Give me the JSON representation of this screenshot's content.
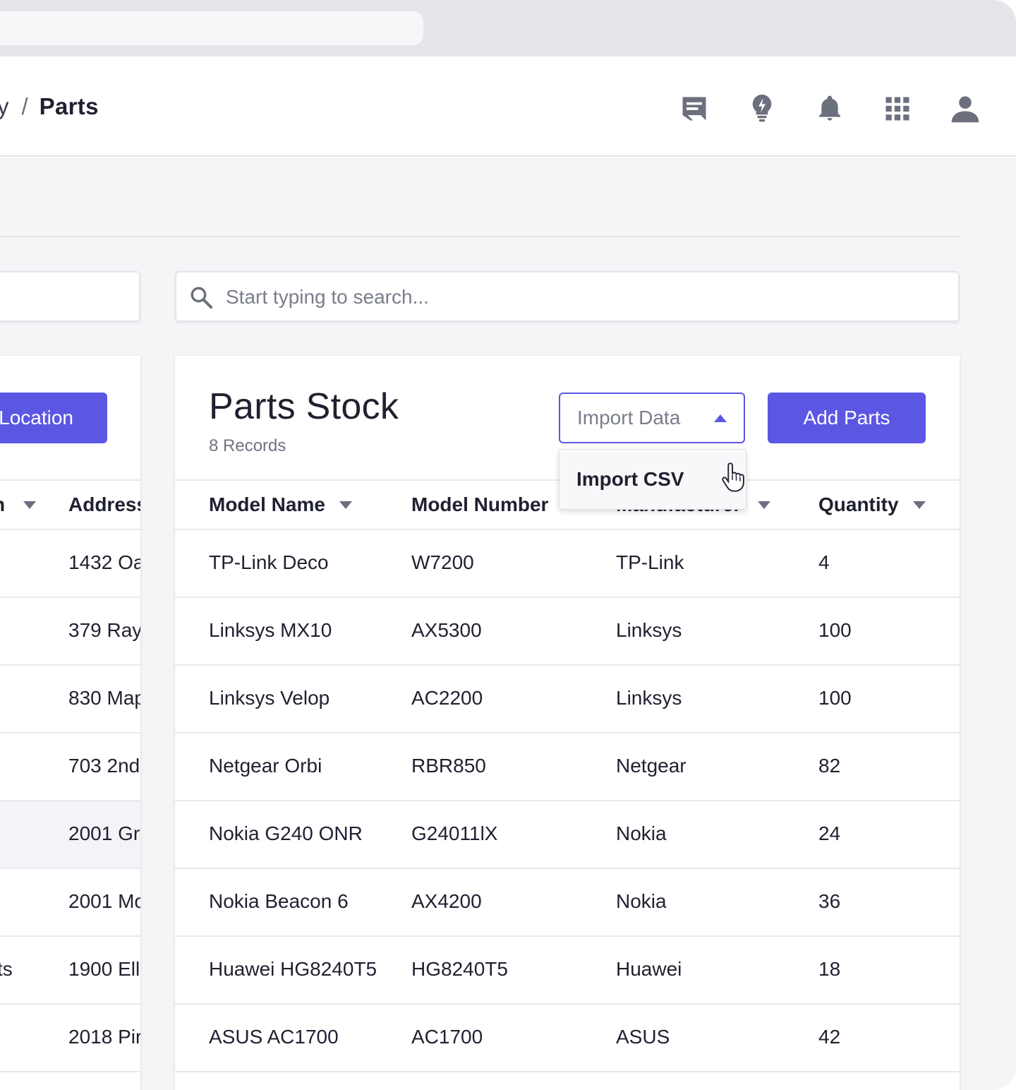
{
  "breadcrumb": {
    "previous": "y",
    "separator": "/",
    "current": "Parts"
  },
  "header_icons": [
    "chat-icon",
    "lightbulb-icon",
    "bell-icon",
    "apps-grid-icon",
    "user-icon"
  ],
  "search": {
    "placeholder": "Start typing to search..."
  },
  "left_panel": {
    "button_label": "Location",
    "columns": [
      "n",
      "Address"
    ],
    "rows": [
      {
        "a": "",
        "b": "1432 Oa"
      },
      {
        "a": "",
        "b": "379 Ray"
      },
      {
        "a": "",
        "b": "830 Map"
      },
      {
        "a": "",
        "b": "703 2nd"
      },
      {
        "a": "",
        "b": "2001 Gr"
      },
      {
        "a": "",
        "b": "2001 Mo"
      },
      {
        "a": "ts",
        "b": "1900 Ell"
      },
      {
        "a": "",
        "b": "2018 Pir"
      }
    ]
  },
  "panel": {
    "title": "Parts Stock",
    "subtitle": "8 Records",
    "import_label": "Import Data",
    "add_label": "Add Parts"
  },
  "dropdown": {
    "items": [
      "Import CSV"
    ]
  },
  "table": {
    "columns": [
      "Model Name",
      "Model Number",
      "Manufacturer",
      "Quantity"
    ],
    "rows": [
      [
        "TP-Link Deco",
        "W7200",
        "TP-Link",
        "4"
      ],
      [
        "Linksys MX10",
        "AX5300",
        "Linksys",
        "100"
      ],
      [
        "Linksys Velop",
        "AC2200",
        "Linksys",
        "100"
      ],
      [
        "Netgear Orbi",
        "RBR850",
        "Netgear",
        "82"
      ],
      [
        "Nokia G240 ONR",
        "G24011lX",
        "Nokia",
        "24"
      ],
      [
        "Nokia Beacon 6",
        "AX4200",
        "Nokia",
        "36"
      ],
      [
        "Huawei HG8240T5",
        "HG8240T5",
        "Huawei",
        "18"
      ],
      [
        "ASUS AC1700",
        "AC1700",
        "ASUS",
        "42"
      ]
    ]
  },
  "colors": {
    "accent": "#5c57e3",
    "background": "#f5f5f7",
    "icon": "#6c6f7d"
  }
}
